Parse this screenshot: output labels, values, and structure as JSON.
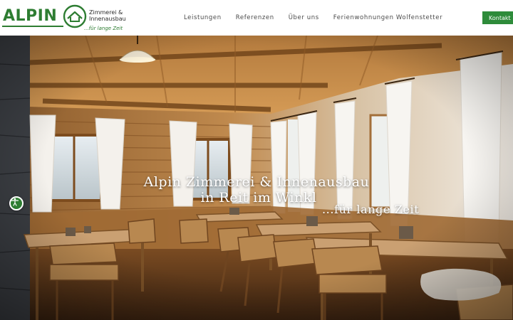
{
  "header": {
    "logo": {
      "word": "ALPIN",
      "name_line1": "Zimmerei  &",
      "name_line2": "Innenausbau",
      "tagline": "...für lange Zeit"
    },
    "nav": [
      {
        "label": "Leistungen"
      },
      {
        "label": "Referenzen"
      },
      {
        "label": "Über uns"
      },
      {
        "label": "Ferienwohnungen Wolfenstetter"
      }
    ],
    "contact_label": "Kontakt"
  },
  "hero": {
    "title_line1": "Alpin Zimmerei & Innenausbau",
    "title_line2": "in Reit im Winkl",
    "subtitle": "...für lange Zeit"
  },
  "icons": {
    "accessibility": "accessibility-icon",
    "logo_emblem": "house-emblem-icon"
  },
  "colors": {
    "brand_green": "#2e7d32",
    "button_green": "#2e8b3a",
    "nav_text": "#4a4a4a"
  }
}
